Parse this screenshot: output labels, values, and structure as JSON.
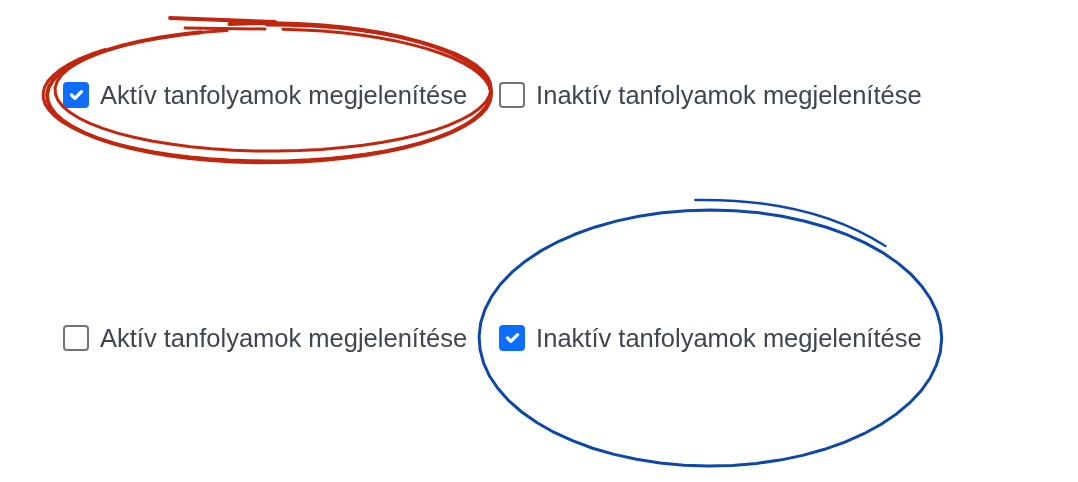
{
  "rows": [
    {
      "options": [
        {
          "label": "Aktív tanfolyamok megjelenítése",
          "checked": true,
          "highlight": {
            "kind": "scribble",
            "color": "#c1270e"
          }
        },
        {
          "label": "Inaktív tanfolyamok megjelenítése",
          "checked": false
        }
      ]
    },
    {
      "options": [
        {
          "label": "Aktív tanfolyamok megjelenítése",
          "checked": false
        },
        {
          "label": "Inaktív tanfolyamok megjelenítése",
          "checked": true,
          "highlight": {
            "kind": "loop",
            "color": "#0d47a8"
          }
        }
      ]
    }
  ]
}
